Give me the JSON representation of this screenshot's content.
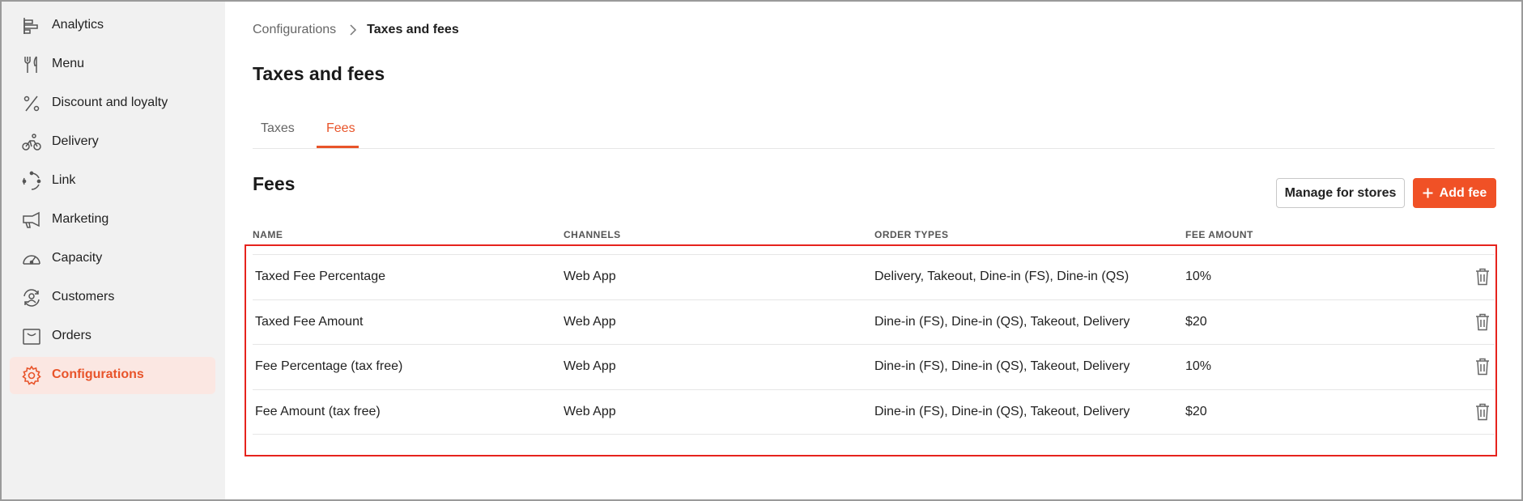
{
  "sidebar": {
    "items": [
      {
        "label": "Analytics",
        "icon": "analytics-icon",
        "active": false
      },
      {
        "label": "Menu",
        "icon": "utensils-icon",
        "active": false
      },
      {
        "label": "Discount and loyalty",
        "icon": "percent-icon",
        "active": false
      },
      {
        "label": "Delivery",
        "icon": "bicycle-icon",
        "active": false
      },
      {
        "label": "Link",
        "icon": "link-circle-icon",
        "active": false
      },
      {
        "label": "Marketing",
        "icon": "megaphone-icon",
        "active": false
      },
      {
        "label": "Capacity",
        "icon": "gauge-icon",
        "active": false
      },
      {
        "label": "Customers",
        "icon": "customer-refresh-icon",
        "active": false
      },
      {
        "label": "Orders",
        "icon": "orders-tray-icon",
        "active": false
      },
      {
        "label": "Configurations",
        "icon": "gear-icon",
        "active": true
      }
    ]
  },
  "breadcrumb": {
    "parent": "Configurations",
    "current": "Taxes and fees"
  },
  "page": {
    "title": "Taxes and fees"
  },
  "tabs": [
    {
      "label": "Taxes",
      "active": false
    },
    {
      "label": "Fees",
      "active": true
    }
  ],
  "fees": {
    "title": "Fees",
    "manage_label": "Manage for stores",
    "add_label": "Add fee",
    "columns": [
      "NAME",
      "CHANNELS",
      "ORDER TYPES",
      "FEE AMOUNT"
    ],
    "rows": [
      {
        "name": "Taxed Fee Percentage",
        "channels": "Web App",
        "order_types": "Delivery, Takeout, Dine-in (FS), Dine-in (QS)",
        "amount": "10%"
      },
      {
        "name": "Taxed Fee Amount",
        "channels": "Web App",
        "order_types": "Dine-in (FS), Dine-in (QS), Takeout, Delivery",
        "amount": "$20"
      },
      {
        "name": "Fee Percentage (tax free)",
        "channels": "Web App",
        "order_types": "Dine-in (FS), Dine-in (QS), Takeout, Delivery",
        "amount": "10%"
      },
      {
        "name": "Fee Amount (tax free)",
        "channels": "Web App",
        "order_types": "Dine-in (FS), Dine-in (QS), Takeout, Delivery",
        "amount": "$20"
      }
    ]
  },
  "colors": {
    "accent": "#e8542a",
    "primary_button": "#f05126",
    "highlight_border": "#e6231d",
    "sidebar_bg": "#f1f1f1",
    "active_item_bg": "#fbe7e2"
  }
}
